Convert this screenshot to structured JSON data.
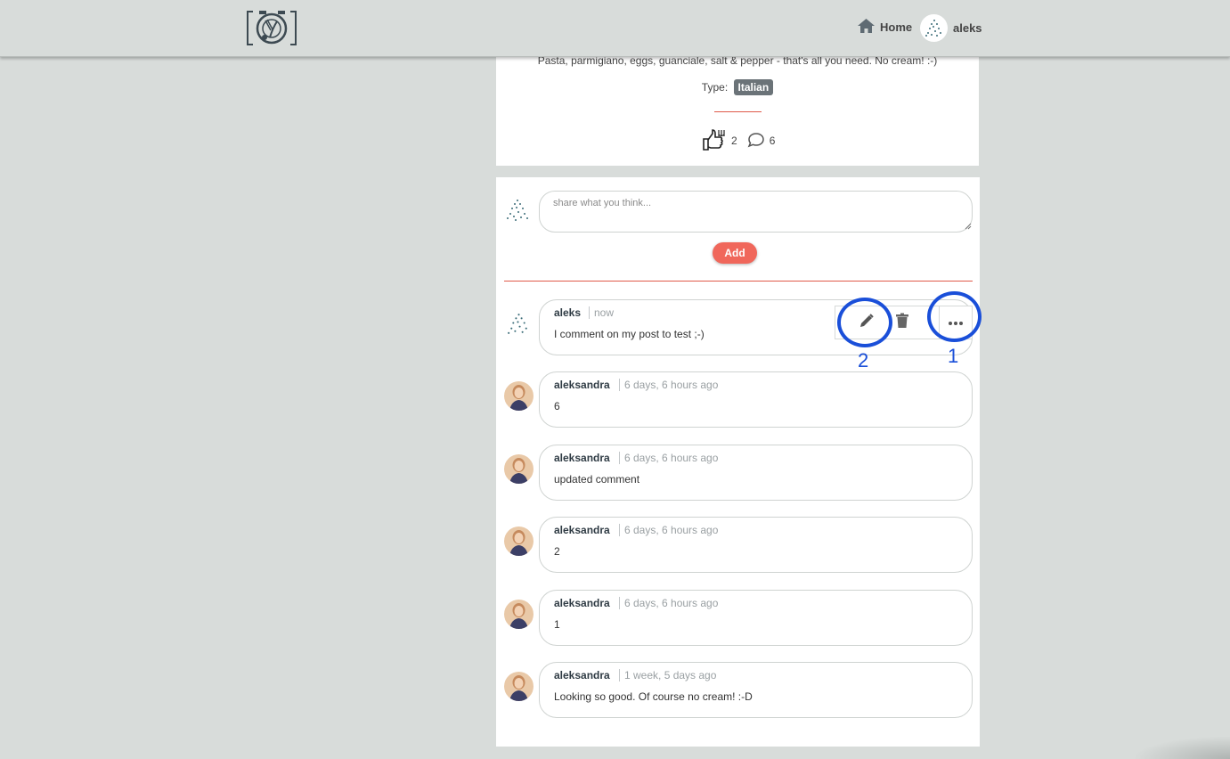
{
  "header": {
    "home_label": "Home",
    "user_name": "aleks"
  },
  "post": {
    "description": "Pasta, parmigiano, eggs, guanciale, salt & pepper - that's all you need. No cream! :-)",
    "type_label": "Type:",
    "type_value": "Italian",
    "likes": "2",
    "comments": "6"
  },
  "new_comment": {
    "placeholder": "share what you think...",
    "add_label": "Add"
  },
  "comments": [
    {
      "author": "aleks",
      "time": "now",
      "text": "I comment on my post to test ;-)"
    },
    {
      "author": "aleksandra",
      "time": "6 days, 6 hours ago",
      "text": "6"
    },
    {
      "author": "aleksandra",
      "time": "6 days, 6 hours ago",
      "text": "updated comment"
    },
    {
      "author": "aleksandra",
      "time": "6 days, 6 hours ago",
      "text": "2"
    },
    {
      "author": "aleksandra",
      "time": "6 days, 6 hours ago",
      "text": "1"
    },
    {
      "author": "aleksandra",
      "time": "1 week, 5 days ago",
      "text": "Looking so good. Of course no cream! :-D"
    }
  ],
  "annotations": {
    "label_1": "1",
    "label_2": "2"
  },
  "icons": {
    "home": "home-icon",
    "like": "thumbs-up-fork-icon",
    "comment": "speech-bubble-icon",
    "edit": "pencil-icon",
    "delete": "trash-icon",
    "more": "ellipsis-icon"
  },
  "colors": {
    "accent": "#f0675b",
    "annotation": "#1a4fd9",
    "badge": "#6b7378"
  }
}
